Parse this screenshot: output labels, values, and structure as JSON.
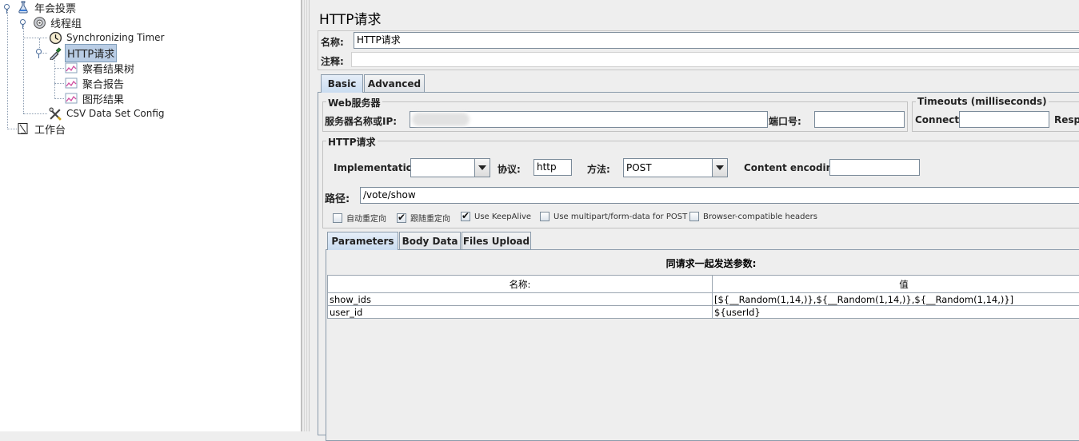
{
  "tree": {
    "items": [
      {
        "label": "年会投票",
        "icon": "test-plan-icon"
      },
      {
        "label": "线程组",
        "icon": "thread-group-gear-icon"
      },
      {
        "label": "Synchronizing Timer",
        "icon": "timer-clock-icon"
      },
      {
        "label": "HTTP请求",
        "icon": "http-sampler-pipette-icon"
      },
      {
        "label": "察看结果树",
        "icon": "listener-graph-icon"
      },
      {
        "label": "聚合报告",
        "icon": "listener-graph-icon"
      },
      {
        "label": "图形结果",
        "icon": "listener-graph-icon"
      },
      {
        "label": "CSV Data Set Config",
        "icon": "config-wrench-icon"
      },
      {
        "label": "工作台",
        "icon": "workbench-icon"
      }
    ]
  },
  "panel": {
    "title": "HTTP请求",
    "name_label": "名称:",
    "name_value": "HTTP请求",
    "comment_label": "注释:",
    "comment_value": "",
    "tabs": [
      {
        "label": "Basic"
      },
      {
        "label": "Advanced"
      }
    ],
    "web_server": {
      "group_title": "Web服务器",
      "server_label": "服务器名称或IP:",
      "server_value": "",
      "port_label": "端口号:",
      "port_value": ""
    },
    "timeouts": {
      "group_title": "Timeouts (milliseconds)",
      "connect_label": "Connect:",
      "connect_value": "",
      "response_label": "Respo"
    },
    "http_request": {
      "group_title": "HTTP请求",
      "implementation_label": "Implementation:",
      "implementation_value": "",
      "protocol_label": "协议:",
      "protocol_value": "http",
      "method_label": "方法:",
      "method_value": "POST",
      "encoding_label": "Content encoding:",
      "encoding_value": "",
      "path_label": "路径:",
      "path_value": "/vote/show"
    },
    "options": [
      {
        "label": "自动重定向",
        "checked": false
      },
      {
        "label": "跟随重定向",
        "checked": true
      },
      {
        "label": "Use KeepAlive",
        "checked": true
      },
      {
        "label": "Use multipart/form-data for POST",
        "checked": false
      },
      {
        "label": "Browser-compatible headers",
        "checked": false
      }
    ],
    "subtabs": [
      {
        "label": "Parameters"
      },
      {
        "label": "Body Data"
      },
      {
        "label": "Files Upload"
      }
    ],
    "params": {
      "caption": "同请求一起发送参数:",
      "col_name": "名称:",
      "col_value": "值",
      "rows": [
        {
          "name": "show_ids",
          "value": "[${__Random(1,14,)},${__Random(1,14,)},${__Random(1,14,)}]"
        },
        {
          "name": "user_id",
          "value": "${userId}"
        }
      ]
    }
  }
}
